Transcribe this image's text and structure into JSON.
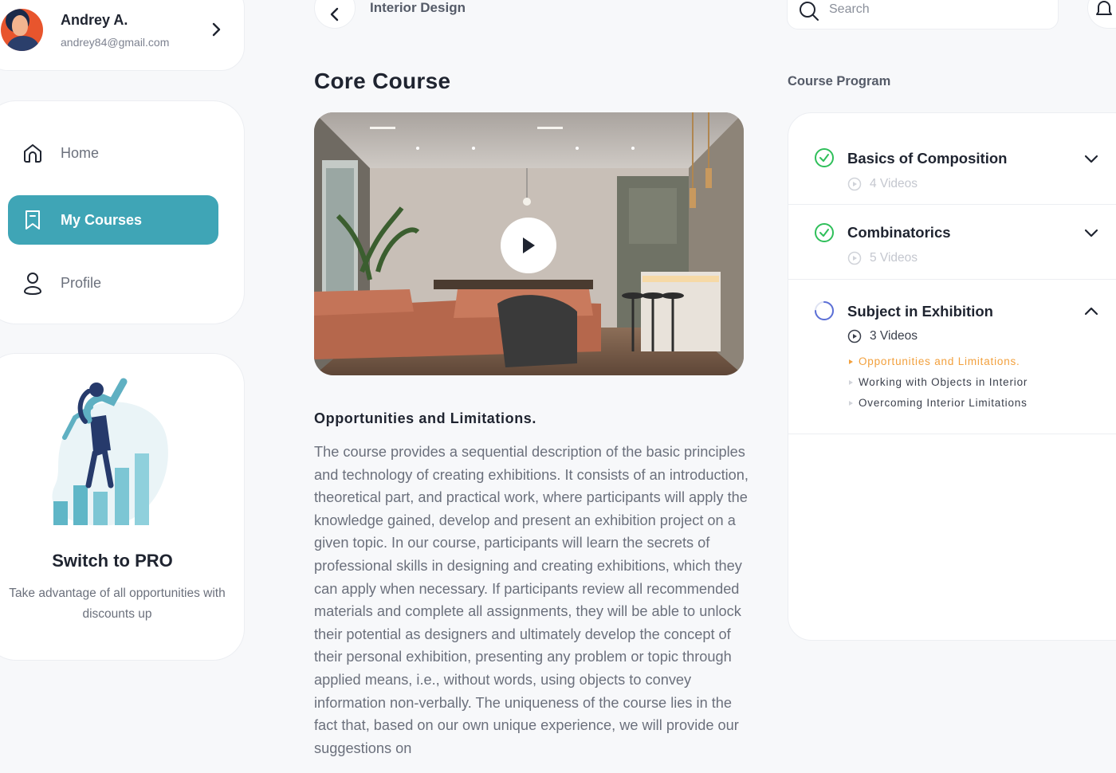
{
  "user": {
    "name": "Andrey A.",
    "email": "andrey84@gmail.com"
  },
  "nav": {
    "items": [
      {
        "label": "Home",
        "icon": "home-icon",
        "active": false
      },
      {
        "label": "My Courses",
        "icon": "bookmark-icon",
        "active": true
      },
      {
        "label": "Profile",
        "icon": "user-icon",
        "active": false
      }
    ]
  },
  "promo": {
    "title": "Switch to PRO",
    "text": "Take advantage of all opportunities with discounts up"
  },
  "header": {
    "breadcrumb": "Interior Design",
    "search_placeholder": "Search"
  },
  "course": {
    "title": "Core Course",
    "lesson_title": "Opportunities and Limitations.",
    "description": "The course provides a sequential description of the basic principles and technology of creating exhibitions. It consists of an introduction, theoretical part, and practical work, where participants will apply the knowledge gained, develop and present an exhibition project on a given topic. In our course, participants will learn the secrets of professional skills in designing and creating exhibitions, which they can apply when necessary. If participants review all recommended materials and complete all assignments, they will be able to unlock their potential as designers and ultimately develop the concept of their personal exhibition, presenting any problem or topic through applied means, i.e., without words, using objects to convey information non-verbally. The uniqueness of the course lies in the fact that, based on our own unique experience, we will provide our suggestions on"
  },
  "program": {
    "label": "Course Program",
    "modules": [
      {
        "title": "Basics of Composition",
        "videos": "4 Videos",
        "status": "completed",
        "expanded": false
      },
      {
        "title": "Combinatorics",
        "videos": "5 Videos",
        "status": "completed",
        "expanded": false
      },
      {
        "title": "Subject in Exhibition",
        "videos": "3 Videos",
        "status": "in-progress",
        "expanded": true,
        "lessons": [
          {
            "title": "Opportunities and Limitations.",
            "current": true
          },
          {
            "title": "Working with Objects in Interior",
            "current": false
          },
          {
            "title": "Overcoming Interior Limitations",
            "current": false
          }
        ]
      }
    ]
  },
  "colors": {
    "accent": "#3fa5b6",
    "success": "#2fbf5a",
    "progress": "#5b6fd6",
    "current_lesson": "#f2a03d"
  }
}
